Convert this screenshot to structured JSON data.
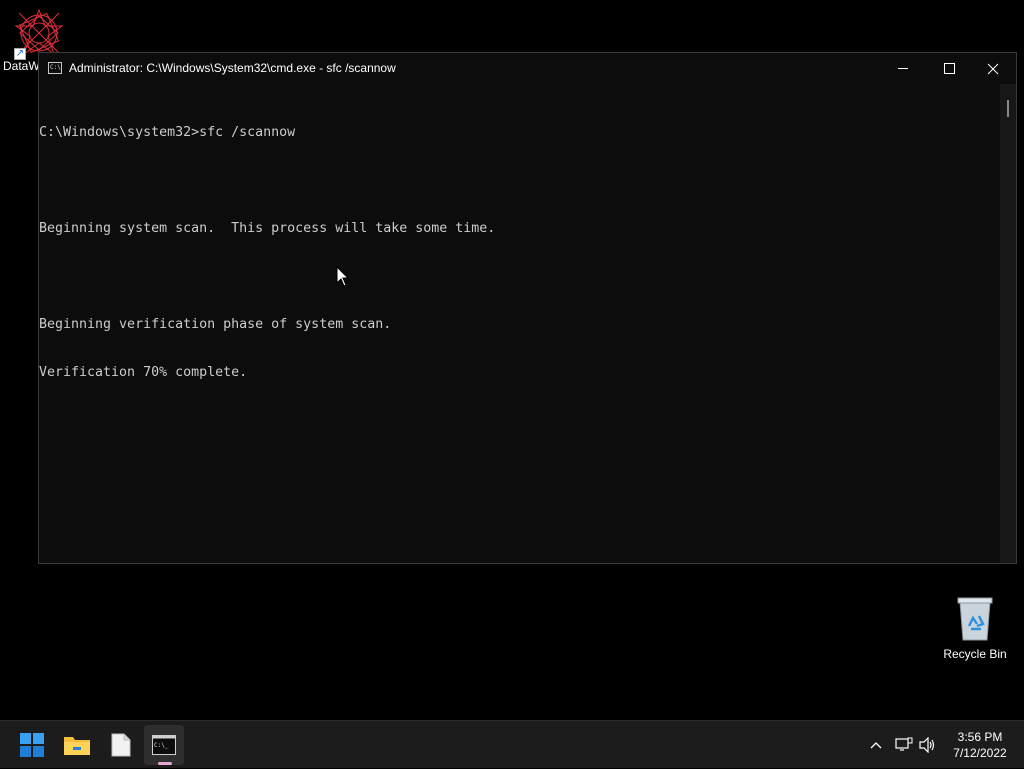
{
  "desktop": {
    "shortcut_label": "DataW",
    "recycle_label": "Recycle Bin"
  },
  "window": {
    "title": "Administrator: C:\\Windows\\System32\\cmd.exe - sfc  /scannow",
    "console_lines": [
      "C:\\Windows\\system32>sfc /scannow",
      "",
      "Beginning system scan.  This process will take some time.",
      "",
      "Beginning verification phase of system scan.",
      "Verification 70% complete."
    ]
  },
  "taskbar": {
    "clock_time": "3:56 PM",
    "clock_date": "7/12/2022"
  },
  "icons": {
    "start": "windows-start-icon",
    "explorer": "folder-icon",
    "notepad": "document-icon",
    "cmd": "terminal-icon",
    "chevron": "chevron-up-icon",
    "network": "network-icon",
    "volume": "speaker-icon"
  },
  "colors": {
    "console_bg": "#0c0c0c",
    "console_text": "#cccccc",
    "taskbar_bg": "#1c1c1c",
    "accent_indicator": "#e8a6d4"
  }
}
